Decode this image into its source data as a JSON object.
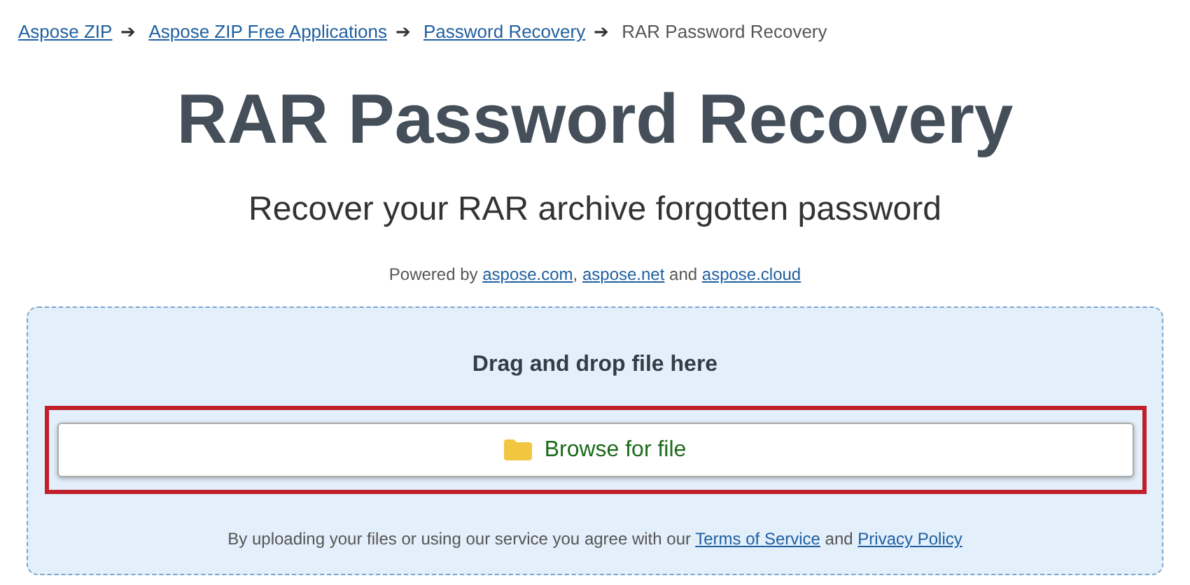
{
  "breadcrumbs": [
    {
      "label": "Aspose ZIP",
      "current": false,
      "arrow": "➔"
    },
    {
      "label": "Aspose ZIP Free Applications",
      "current": false,
      "arrow": "➔"
    },
    {
      "label": "Password Recovery",
      "current": false,
      "arrow": "➔"
    },
    {
      "label": "RAR Password Recovery",
      "current": true
    }
  ],
  "title": "RAR Password Recovery",
  "subtitle": "Recover your RAR archive forgotten password",
  "powered_by": [
    {
      "text": "Powered by ",
      "link": false
    },
    {
      "text": "aspose.com",
      "link": true
    },
    {
      "text": ", ",
      "link": false
    },
    {
      "text": "aspose.net",
      "link": true
    },
    {
      "text": " and ",
      "link": false
    },
    {
      "text": "aspose.cloud",
      "link": true
    }
  ],
  "upload": {
    "heading": "Drag and drop file here",
    "button": {
      "label": "Browse for file",
      "highlighted": true
    },
    "notice": [
      {
        "text": "By uploading your files or using our service you agree with our ",
        "link": false
      },
      {
        "text": "Terms of Service",
        "link": true
      },
      {
        "text": " and ",
        "link": false
      },
      {
        "text": "Privacy Policy",
        "link": true
      }
    ]
  }
}
